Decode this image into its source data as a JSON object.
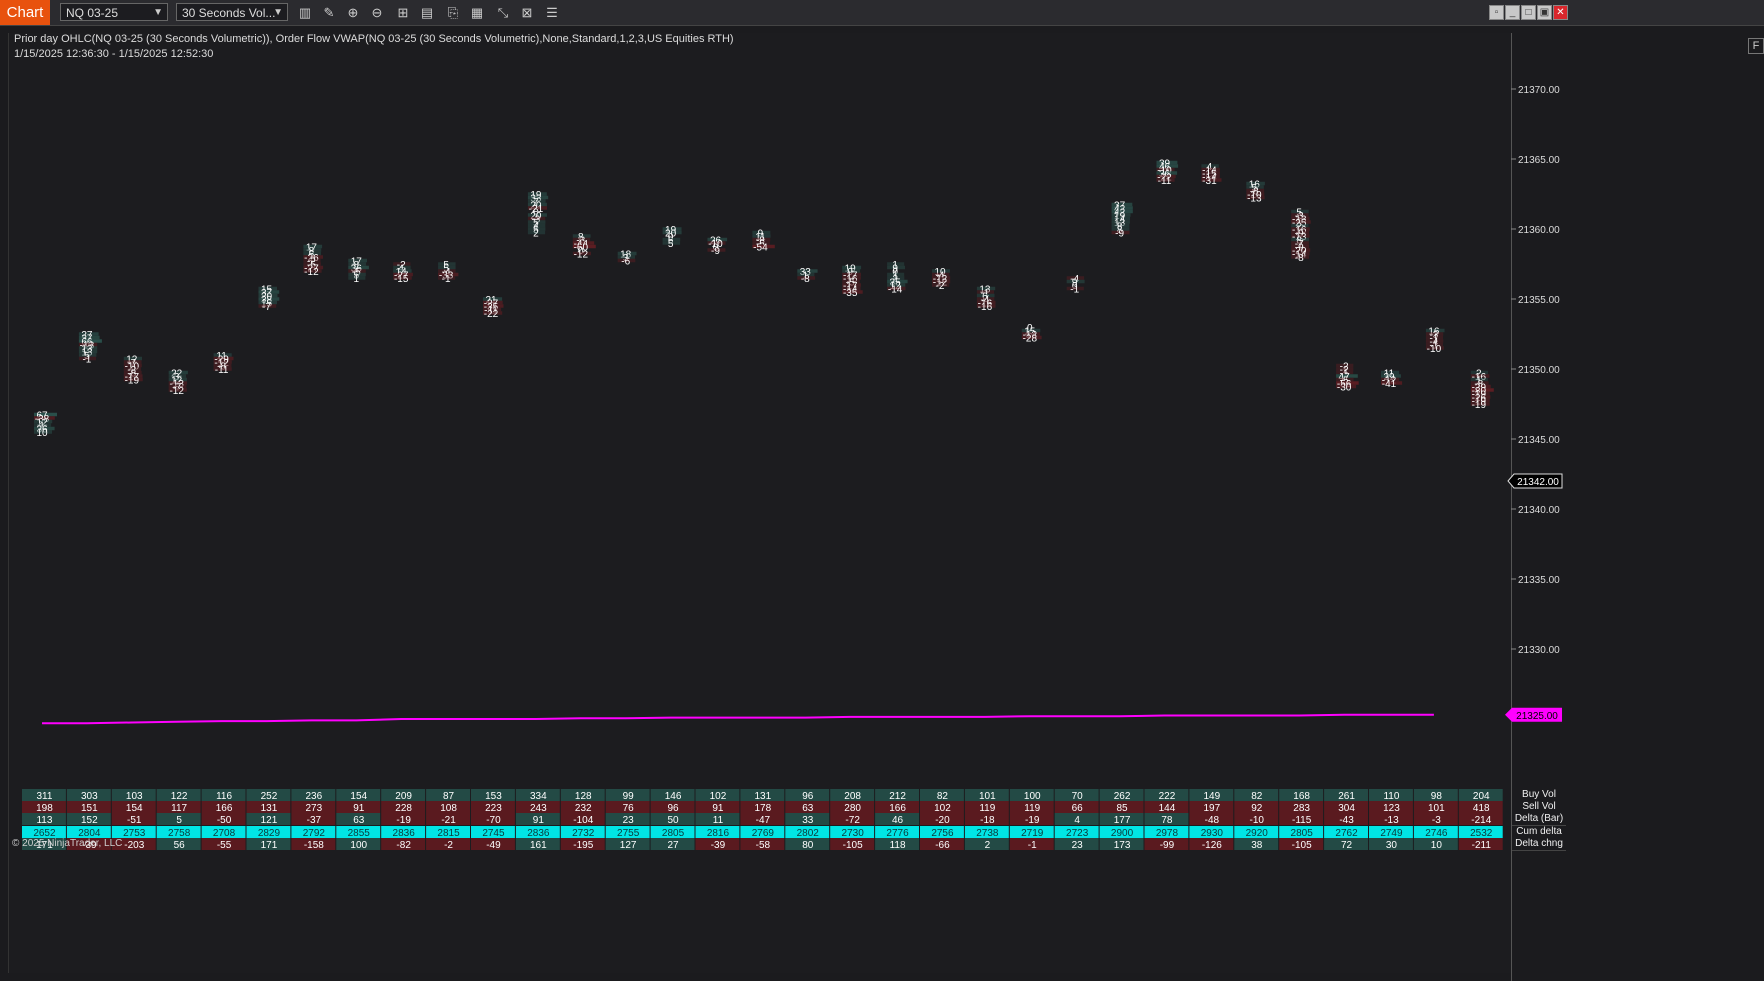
{
  "toolbar": {
    "chart_tab": "Chart",
    "instrument": "NQ 03-25",
    "period": "30 Seconds Vol..."
  },
  "info": {
    "indicators": "Prior day OHLC(NQ 03-25 (30 Seconds Volumetric)), Order Flow VWAP(NQ 03-25 (30 Seconds Volumetric),None,Standard,1,2,3,US Equities RTH)",
    "date_range": "1/15/2025 12:36:30 - 1/15/2025 12:52:30"
  },
  "axis": {
    "f_button": "F",
    "current_price_label": "21342.00",
    "vwap_label": "21325.00",
    "y_ticks": [
      "21370.00",
      "21365.00",
      "21360.00",
      "21355.00",
      "21350.00",
      "21345.00",
      "21340.00",
      "21335.00",
      "21330.00"
    ]
  },
  "copyright": "© 2025 NinjaTrader, LLC",
  "colors": {
    "positive_cell": "#2a4f4a",
    "negative_cell": "#5c1d22",
    "vwap": "#ff00ff",
    "cum_delta": "#00e5e5"
  },
  "chart_data": {
    "type": "footprint",
    "ylim": [
      21324,
      21374
    ],
    "current_price": 21342.0,
    "vwap": {
      "label": "21325.00",
      "values": [
        21324.7,
        21324.7,
        21324.75,
        21324.8,
        21324.85,
        21324.85,
        21324.9,
        21324.9,
        21325.0,
        21325.0,
        21325.0,
        21325.0,
        21325.05,
        21325.05,
        21325.1,
        21325.1,
        21325.1,
        21325.1,
        21325.15,
        21325.15,
        21325.15,
        21325.15,
        21325.2,
        21325.2,
        21325.2,
        21325.25,
        21325.25,
        21325.25,
        21325.25,
        21325.3,
        21325.3,
        21325.3
      ]
    },
    "bars": [
      {
        "top": 21346.75,
        "cells": [
          "67",
          "-38",
          "12",
          "1",
          "36",
          "10"
        ]
      },
      {
        "top": 21352.5,
        "cells": [
          "27",
          "37",
          "66",
          "-13",
          "13",
          "13",
          "5",
          "-1"
        ]
      },
      {
        "top": 21350.75,
        "cells": [
          "12",
          "-7",
          "-10",
          "-2",
          "-8",
          "-17",
          "-19"
        ]
      },
      {
        "top": 21349.75,
        "cells": [
          "22",
          "3",
          "12",
          "-13",
          "-7",
          "-12"
        ]
      },
      {
        "top": 21351.0,
        "cells": [
          "11",
          "-29",
          "-12",
          "-8",
          "-11"
        ]
      },
      {
        "top": 21355.75,
        "cells": [
          "15",
          "37",
          "20",
          "38",
          "15",
          "-7"
        ]
      },
      {
        "top": 21358.75,
        "cells": [
          "17",
          "8",
          "6",
          "-26",
          "-2",
          "-5",
          "-27",
          "-12"
        ]
      },
      {
        "top": 21357.75,
        "cells": [
          "17",
          "8",
          "36",
          "-5",
          "5",
          "1"
        ]
      },
      {
        "top": 21357.5,
        "cells": [
          "-2",
          "4",
          "14",
          "-27",
          "-15"
        ]
      },
      {
        "top": 21357.5,
        "cells": [
          "5",
          "5",
          "-4",
          "-33",
          "-1"
        ]
      },
      {
        "top": 21355.0,
        "cells": [
          "21",
          "-27",
          "-35",
          "-11",
          "-22"
        ]
      },
      {
        "top": 21362.5,
        "cells": [
          "19",
          "33",
          "7",
          "20",
          "-21",
          "0",
          "20",
          "-3",
          "5",
          "4",
          "5",
          "2"
        ]
      },
      {
        "top": 21359.5,
        "cells": [
          "8",
          "-3",
          "-44",
          "-60",
          "0",
          "-12"
        ]
      },
      {
        "top": 21358.25,
        "cells": [
          "18",
          "3",
          "-6"
        ]
      },
      {
        "top": 21360.0,
        "cells": [
          "19",
          "20",
          "0",
          "6",
          "5"
        ]
      },
      {
        "top": 21359.25,
        "cells": [
          "26",
          "-10",
          "0",
          "-9"
        ]
      },
      {
        "top": 21359.75,
        "cells": [
          "9",
          "11",
          "-8",
          "-5",
          "-54"
        ]
      },
      {
        "top": 21357.0,
        "cells": [
          "33",
          "1",
          "-8"
        ]
      },
      {
        "top": 21357.25,
        "cells": [
          "19",
          "9",
          "-17",
          "-16",
          "-5",
          "-17",
          "-14",
          "-35"
        ]
      },
      {
        "top": 21357.5,
        "cells": [
          "1",
          "9",
          "0",
          "1",
          "2",
          "35",
          "12",
          "-14"
        ]
      },
      {
        "top": 21357.0,
        "cells": [
          "10",
          "-4",
          "-12",
          "-12",
          "-2"
        ]
      },
      {
        "top": 21355.75,
        "cells": [
          "13",
          "-1",
          "6",
          "-4",
          "-16",
          "-16"
        ]
      },
      {
        "top": 21353.0,
        "cells": [
          "0",
          "15",
          "-12",
          "-28"
        ]
      },
      {
        "top": 21356.5,
        "cells": [
          "-4",
          "9",
          "0",
          "-1"
        ]
      },
      {
        "top": 21361.75,
        "cells": [
          "37",
          "42",
          "42",
          "19",
          "14",
          "13",
          "8",
          "8",
          "-9"
        ]
      },
      {
        "top": 21364.75,
        "cells": [
          "39",
          "46",
          "-10",
          "36",
          "-22",
          "-11"
        ]
      },
      {
        "top": 21364.5,
        "cells": [
          "4",
          "-14",
          "-15",
          "-14",
          "-31"
        ]
      },
      {
        "top": 21363.25,
        "cells": [
          "16",
          "5",
          "-8",
          "-10",
          "-13"
        ]
      },
      {
        "top": 21361.25,
        "cells": [
          "5",
          "-3",
          "-13",
          "-25",
          "2",
          "-16",
          "-9",
          "-13",
          "8",
          "-7",
          "-9",
          "-20",
          "-14",
          "-8"
        ]
      },
      {
        "top": 21350.25,
        "cells": [
          "-2",
          "-2",
          "-1",
          "47",
          "-5",
          "-56",
          "-30"
        ]
      },
      {
        "top": 21349.75,
        "cells": [
          "11",
          "29",
          "-12",
          "-41"
        ]
      },
      {
        "top": 21352.75,
        "cells": [
          "16",
          "-3",
          "-1",
          "-4",
          "-1",
          "-10"
        ]
      },
      {
        "top": 21349.75,
        "cells": [
          "2",
          "-16",
          "1",
          "-8",
          "-29",
          "-80",
          "-19",
          "-26",
          "-19",
          "-19"
        ]
      }
    ],
    "summary": {
      "row_labels": [
        "Buy Vol",
        "Sell Vol",
        "Delta (Bar)",
        "Cum delta",
        "Delta chng"
      ],
      "buy_vol": [
        311,
        303,
        103,
        122,
        116,
        252,
        236,
        154,
        209,
        87,
        153,
        334,
        128,
        99,
        146,
        102,
        131,
        96,
        208,
        212,
        82,
        101,
        100,
        70,
        262,
        222,
        149,
        82,
        168,
        261,
        110,
        98,
        204
      ],
      "sell_vol": [
        198,
        151,
        154,
        117,
        166,
        131,
        273,
        91,
        228,
        108,
        223,
        243,
        232,
        76,
        96,
        91,
        178,
        63,
        280,
        166,
        102,
        119,
        119,
        66,
        85,
        144,
        197,
        92,
        283,
        304,
        123,
        101,
        418
      ],
      "delta_bar": [
        113,
        152,
        -51,
        5,
        -50,
        121,
        -37,
        63,
        -19,
        -21,
        -70,
        91,
        -104,
        23,
        50,
        11,
        -47,
        33,
        -72,
        46,
        -20,
        -18,
        -19,
        4,
        177,
        78,
        -48,
        -10,
        -115,
        -43,
        -13,
        -3,
        -214
      ],
      "cum_delta": [
        2652,
        2804,
        2753,
        2758,
        2708,
        2829,
        2792,
        2855,
        2836,
        2815,
        2745,
        2836,
        2732,
        2755,
        2805,
        2816,
        2769,
        2802,
        2730,
        2776,
        2756,
        2738,
        2719,
        2723,
        2900,
        2978,
        2930,
        2920,
        2805,
        2762,
        2749,
        2746,
        2532
      ],
      "delta_chng": [
        171,
        -39,
        -203,
        56,
        -55,
        171,
        -158,
        100,
        -82,
        -2,
        -49,
        161,
        -195,
        127,
        27,
        -39,
        -58,
        80,
        -105,
        118,
        -66,
        2,
        -1,
        23,
        173,
        -99,
        -126,
        38,
        -105,
        72,
        30,
        10,
        -211
      ]
    }
  }
}
